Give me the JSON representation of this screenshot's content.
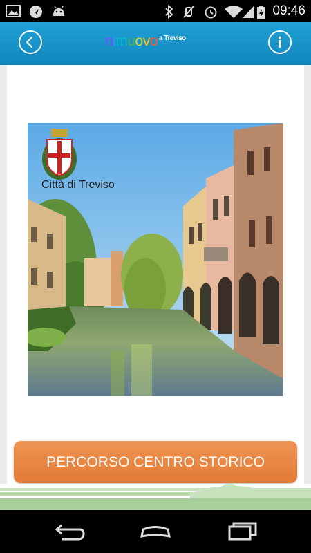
{
  "status_bar": {
    "time": "09:46",
    "icons": [
      "image-icon",
      "navigation-icon",
      "android-icon",
      "bluetooth-icon",
      "mute-icon",
      "alarm-icon",
      "wifi-icon",
      "battery-charging-icon",
      "signal-icon"
    ]
  },
  "app_bar": {
    "logo_main": "nimuovo",
    "logo_sub": "a Treviso",
    "logo_colors": [
      "#7c4dff",
      "#3f8efc",
      "#00bcd4",
      "#4caf50",
      "#cddc39",
      "#ffc107",
      "#ff5722"
    ],
    "back_icon": "chevron-left-icon",
    "info_icon": "info-icon"
  },
  "main": {
    "image_caption": "Città di Treviso",
    "route_button": "PERCORSO CENTRO STORICO"
  },
  "nav_bar": {
    "icons": [
      "back-icon",
      "home-icon",
      "recent-apps-icon"
    ]
  },
  "colors": {
    "app_bar": "#1693c9",
    "button": "#e8843f",
    "footer_green": "#a9cf9a"
  }
}
